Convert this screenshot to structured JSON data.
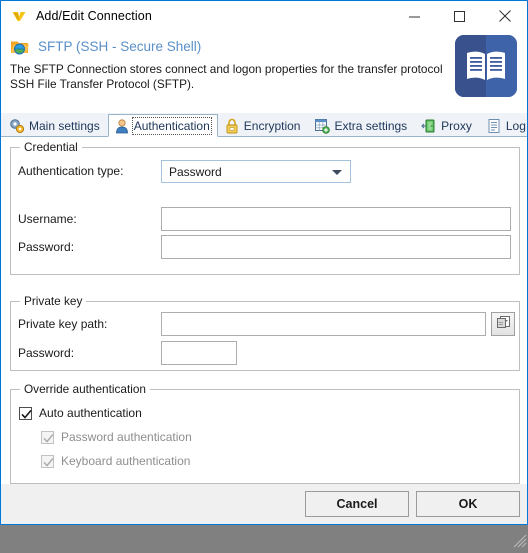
{
  "window": {
    "title": "Add/Edit Connection",
    "title_icon": "winscp-logo-icon",
    "controls": {
      "minimize": "minimize-icon",
      "maximize": "maximize-icon",
      "close": "close-icon"
    }
  },
  "header": {
    "icon": "sftp-folder-globe-icon",
    "title": "SFTP (SSH - Secure Shell)",
    "description": "The SFTP Connection stores connect and logon properties for the transfer protocol SSH File Transfer Protocol (SFTP).",
    "side_icon": "book-icon"
  },
  "tabs": [
    {
      "label": "Main settings",
      "icon": "gears-icon",
      "active": false
    },
    {
      "label": "Authentication",
      "icon": "user-icon",
      "active": true
    },
    {
      "label": "Encryption",
      "icon": "padlock-icon",
      "active": false
    },
    {
      "label": "Extra settings",
      "icon": "spreadsheet-icon",
      "active": false
    },
    {
      "label": "Proxy",
      "icon": "door-exit-icon",
      "active": false
    },
    {
      "label": "Log",
      "icon": "document-icon",
      "active": false
    }
  ],
  "credential": {
    "group_title": "Credential",
    "auth_type_label": "Authentication type:",
    "auth_type_value": "Password",
    "auth_type_options": [
      "Password"
    ],
    "username_label": "Username:",
    "username_value": "",
    "username_placeholder": "",
    "password_label": "Password:",
    "password_value": "",
    "password_placeholder": ""
  },
  "private_key": {
    "group_title": "Private key",
    "path_label": "Private key path:",
    "path_value": "",
    "path_placeholder": "",
    "browse_icon": "browse-folder-icon",
    "password_label": "Password:",
    "password_value": "",
    "password_placeholder": ""
  },
  "override": {
    "group_title": "Override authentication",
    "items": [
      {
        "label": "Auto authentication",
        "checked": true,
        "enabled": true
      },
      {
        "label": "Password authentication",
        "checked": true,
        "enabled": false
      },
      {
        "label": "Keyboard authentication",
        "checked": true,
        "enabled": false
      }
    ]
  },
  "footer": {
    "cancel_label": "Cancel",
    "ok_label": "OK"
  },
  "colors": {
    "window_border": "#0078d7",
    "header_title": "#5a8fc8",
    "tab_text": "#21385c",
    "tabstrip_bg": "#eff3f7",
    "book_icon_blue": "#3d5a9e",
    "desktop_bg": "#808080"
  }
}
